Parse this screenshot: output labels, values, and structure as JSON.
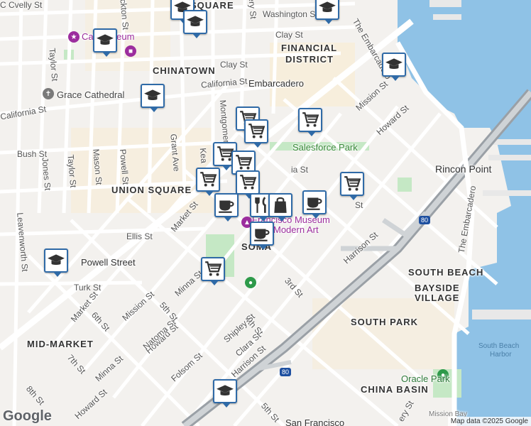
{
  "map": {
    "neighborhoods": [
      {
        "id": "chinatown",
        "text": "CHINATOWN"
      },
      {
        "id": "financial-district-1",
        "text": "FINANCIAL"
      },
      {
        "id": "financial-district-2",
        "text": "DISTRICT"
      },
      {
        "id": "union-square",
        "text": "UNION SQUARE"
      },
      {
        "id": "soma",
        "text": "SOMA"
      },
      {
        "id": "south-beach",
        "text": "SOUTH BEACH"
      },
      {
        "id": "bayside-1",
        "text": "BAYSIDE"
      },
      {
        "id": "bayside-2",
        "text": "VILLAGE"
      },
      {
        "id": "south-park",
        "text": "SOUTH PARK"
      },
      {
        "id": "mid-market",
        "text": "MID-MARKET"
      },
      {
        "id": "china-basin",
        "text": "CHINA BASIN"
      }
    ],
    "streets": [
      {
        "id": "clay-1",
        "text": "Clay St"
      },
      {
        "id": "clay-2",
        "text": "Clay St"
      },
      {
        "id": "washington",
        "text": "Washington St"
      },
      {
        "id": "california-1",
        "text": "California St"
      },
      {
        "id": "california-2",
        "text": "California St"
      },
      {
        "id": "bush",
        "text": "Bush St"
      },
      {
        "id": "ellis",
        "text": "Ellis St"
      },
      {
        "id": "turk",
        "text": "Turk St"
      },
      {
        "id": "market-1",
        "text": "Market St"
      },
      {
        "id": "market-2",
        "text": "Market St"
      },
      {
        "id": "mission-1",
        "text": "Mission St"
      },
      {
        "id": "mission-2",
        "text": "Mission St"
      },
      {
        "id": "howard-1",
        "text": "Howard St"
      },
      {
        "id": "howard-2",
        "text": "Howard St"
      },
      {
        "id": "howard-3",
        "text": "Howard St"
      },
      {
        "id": "folsom",
        "text": "Folsom St"
      },
      {
        "id": "harrison-1",
        "text": "Harrison St"
      },
      {
        "id": "harrison-2",
        "text": "Harrison St"
      },
      {
        "id": "minna-1",
        "text": "Minna St"
      },
      {
        "id": "minna-2",
        "text": "Minna St"
      },
      {
        "id": "natoma",
        "text": "Natoma St"
      },
      {
        "id": "third",
        "text": "3rd St"
      },
      {
        "id": "fourth",
        "text": "4th St"
      },
      {
        "id": "fifth-1",
        "text": "5th St"
      },
      {
        "id": "fifth-2",
        "text": "5th St"
      },
      {
        "id": "sixth",
        "text": "6th St"
      },
      {
        "id": "seventh",
        "text": "7th St"
      },
      {
        "id": "eighth",
        "text": "8th St"
      },
      {
        "id": "shipley",
        "text": "Shipley St"
      },
      {
        "id": "clara",
        "text": "Clara St"
      },
      {
        "id": "jones",
        "text": "Jones St"
      },
      {
        "id": "taylor-1",
        "text": "Taylor St"
      },
      {
        "id": "taylor-2",
        "text": "Taylor St"
      },
      {
        "id": "mason",
        "text": "Mason St"
      },
      {
        "id": "powell",
        "text": "Powell St"
      },
      {
        "id": "grant",
        "text": "Grant Ave"
      },
      {
        "id": "kearny",
        "text": "Kea"
      },
      {
        "id": "montgomery",
        "text": "Montgomer"
      },
      {
        "id": "stockton",
        "text": "ockton St"
      },
      {
        "id": "sansome",
        "text": "ery St"
      },
      {
        "id": "leavenworth",
        "text": "Leavenworth St"
      },
      {
        "id": "embarcadero-1",
        "text": "The Embarcadero"
      },
      {
        "id": "embarcadero-2",
        "text": "The Embarcadero"
      },
      {
        "id": "cvelly",
        "text": "C Cvelly St"
      },
      {
        "id": "square-top",
        "text": "SQUARE"
      },
      {
        "id": "st-right",
        "text": "St"
      },
      {
        "id": "ia-st",
        "text": "ia St"
      },
      {
        "id": "ery-st-bottom",
        "text": "ery St"
      }
    ],
    "pois": [
      {
        "id": "cable-car-museum",
        "text": "Car Museum"
      },
      {
        "id": "grace-cathedral",
        "text": "Grace Cathedral"
      },
      {
        "id": "embarcadero-station",
        "text": "Embarcadero"
      },
      {
        "id": "salesforce-park",
        "text": "Salesforce Park"
      },
      {
        "id": "sfmoma-1",
        "text": "Francisco Museum"
      },
      {
        "id": "sfmoma-2",
        "text": "Modern Art"
      },
      {
        "id": "powell-station",
        "text": "Powell Street"
      },
      {
        "id": "oracle-park",
        "text": "Oracle Park"
      },
      {
        "id": "rincon-point",
        "text": "Rincon Point"
      },
      {
        "id": "sf-station",
        "text": "San Francisco"
      }
    ],
    "water_labels": [
      {
        "id": "south-beach-harbor-1",
        "text": "South Beach"
      },
      {
        "id": "south-beach-harbor-2",
        "text": "Harbor"
      },
      {
        "id": "mission-bay",
        "text": "Mission Bay"
      }
    ],
    "highway_shields": [
      {
        "id": "i80-1",
        "text": "80"
      },
      {
        "id": "i80-2",
        "text": "80"
      }
    ],
    "markers": [
      {
        "id": "m1",
        "icon": "school"
      },
      {
        "id": "m2",
        "icon": "school"
      },
      {
        "id": "m3",
        "icon": "school"
      },
      {
        "id": "m4",
        "icon": "school"
      },
      {
        "id": "m5",
        "icon": "school"
      },
      {
        "id": "m6",
        "icon": "school"
      },
      {
        "id": "m7",
        "icon": "school"
      },
      {
        "id": "m8",
        "icon": "school"
      },
      {
        "id": "m9",
        "icon": "cart"
      },
      {
        "id": "m10",
        "icon": "cart"
      },
      {
        "id": "m11",
        "icon": "cart"
      },
      {
        "id": "m12",
        "icon": "cart"
      },
      {
        "id": "m13",
        "icon": "cart"
      },
      {
        "id": "m14",
        "icon": "cart"
      },
      {
        "id": "m15",
        "icon": "cart"
      },
      {
        "id": "m16",
        "icon": "cart"
      },
      {
        "id": "m17",
        "icon": "cart"
      },
      {
        "id": "m18",
        "icon": "coffee"
      },
      {
        "id": "m19",
        "icon": "coffee"
      },
      {
        "id": "m20",
        "icon": "coffee"
      },
      {
        "id": "m21",
        "icon": "restaurant"
      },
      {
        "id": "m22",
        "icon": "shopping-bag"
      }
    ],
    "logo": "Google",
    "attribution": "Map data ©2025 Google",
    "colors": {
      "water": "#8fc2e6",
      "park": "#c5e8c5",
      "marker_border": "#2f6aa7",
      "poi": "#9c2d9e",
      "transit": "#333333",
      "freeway": "#9aa0a6"
    }
  }
}
